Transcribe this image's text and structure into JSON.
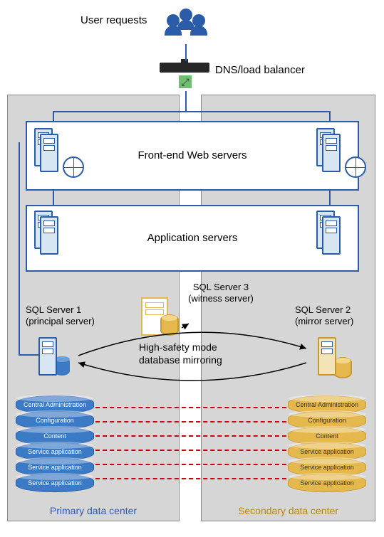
{
  "title": "User requests",
  "dns": "DNS/load balancer",
  "tiers": {
    "web": "Front-end Web servers",
    "app": "Application servers"
  },
  "sql": {
    "s1": {
      "name": "SQL Server 1",
      "role": "(principal server)"
    },
    "s2": {
      "name": "SQL Server 2",
      "role": "(mirror server)"
    },
    "s3": {
      "name": "SQL Server 3",
      "role": "(witness server)"
    }
  },
  "mirror": {
    "line1": "High-safety mode",
    "line2": "database mirroring"
  },
  "dc": {
    "primary": "Primary data center",
    "secondary": "Secondary data center"
  },
  "dbs": [
    "Central Administration",
    "Configuration",
    "Content",
    "Service application",
    "Service application",
    "Service application"
  ]
}
